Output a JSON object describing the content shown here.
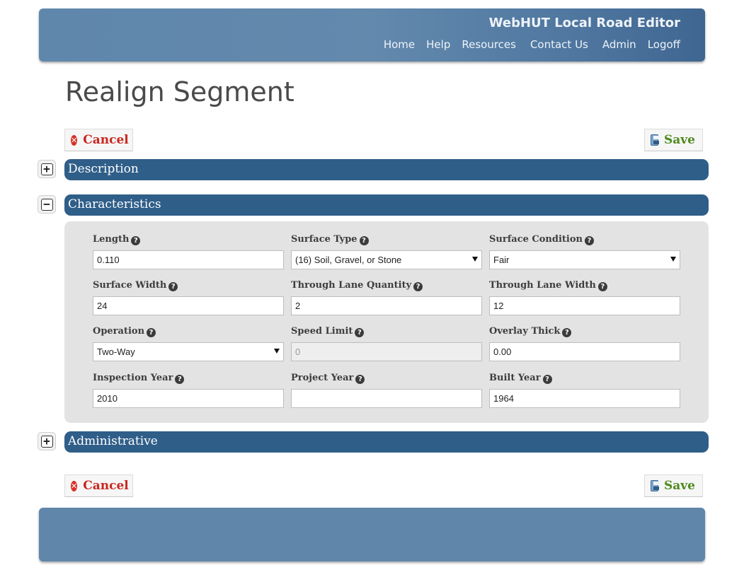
{
  "header": {
    "app_title": "WebHUT Local Road Editor",
    "nav": [
      "Home",
      "Help",
      "Resources",
      "Contact Us",
      "Admin",
      "Logoff"
    ]
  },
  "page_title": "Realign Segment",
  "actions": {
    "cancel_label": "Cancel",
    "save_label": "Save"
  },
  "sections": {
    "description": {
      "title": "Description",
      "expanded": false,
      "toggle_symbol": "+"
    },
    "characteristics": {
      "title": "Characteristics",
      "expanded": true,
      "toggle_symbol": "−"
    },
    "administrative": {
      "title": "Administrative",
      "expanded": false,
      "toggle_symbol": "+"
    }
  },
  "help_glyph": "?",
  "characteristics": {
    "fields": [
      {
        "label": "Length",
        "value": "0.110",
        "type": "text"
      },
      {
        "label": "Surface Type",
        "value": "(16) Soil, Gravel, or Stone",
        "type": "select"
      },
      {
        "label": "Surface Condition",
        "value": "Fair",
        "type": "select"
      },
      {
        "label": "Surface Width",
        "value": "24",
        "type": "text"
      },
      {
        "label": "Through Lane Quantity",
        "value": "2",
        "type": "text"
      },
      {
        "label": "Through Lane Width",
        "value": "12",
        "type": "text"
      },
      {
        "label": "Operation",
        "value": "Two-Way",
        "type": "select"
      },
      {
        "label": "Speed Limit",
        "value": "0",
        "type": "text",
        "disabled": true
      },
      {
        "label": "Overlay Thick",
        "value": "0.00",
        "type": "text"
      },
      {
        "label": "Inspection Year",
        "value": "2010",
        "type": "text"
      },
      {
        "label": "Project Year",
        "value": "",
        "type": "text"
      },
      {
        "label": "Built Year",
        "value": "1964",
        "type": "text"
      }
    ]
  },
  "colors": {
    "section_bar": "#2f5e89",
    "header_bg": "#5f87ab",
    "cancel_text": "#c9261e",
    "save_text": "#4f8a1f"
  }
}
